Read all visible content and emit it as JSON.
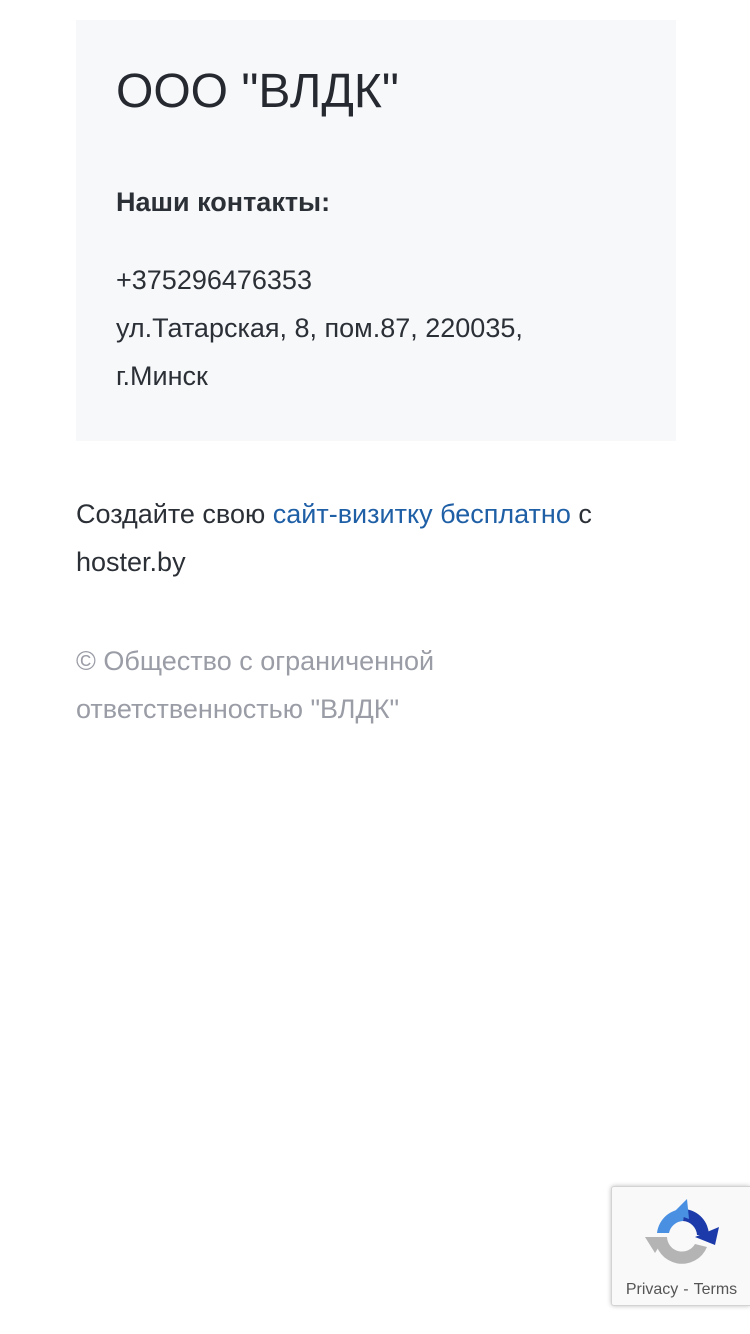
{
  "contact_card": {
    "company_name": "ООО \"ВЛДК\"",
    "contacts_heading": "Наши контакты:",
    "phone": "+375296476353",
    "address_line1": "ул.Татарская, 8, пом.87, 220035,",
    "address_line2": "г.Минск"
  },
  "promo": {
    "text_before": "Создайте свою ",
    "link_text": "сайт-визитку бесплатно",
    "text_after": " с hoster.by"
  },
  "footer": {
    "copyright": "© Общество с ограниченной ответственностью \"ВЛДК\""
  },
  "recaptcha": {
    "icon": "recaptcha-icon",
    "privacy_label": "Privacy",
    "separator": "-",
    "terms_label": "Terms"
  },
  "colors": {
    "card_background": "#f7f8fa",
    "link": "#1f5fa6",
    "muted_text": "#9a9ca6"
  }
}
